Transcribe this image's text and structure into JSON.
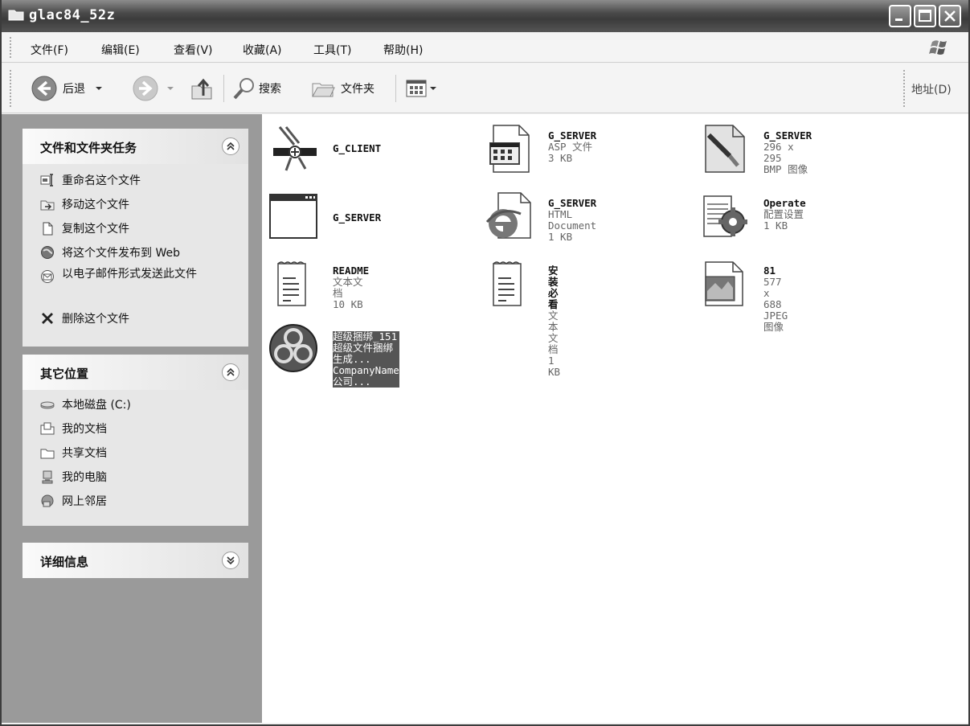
{
  "window": {
    "title": "glac84_52z"
  },
  "menubar": {
    "items": [
      "文件(F)",
      "编辑(E)",
      "查看(V)",
      "收藏(A)",
      "工具(T)",
      "帮助(H)"
    ]
  },
  "toolbar": {
    "back_label": "后退",
    "search_label": "搜索",
    "folders_label": "文件夹",
    "address_label": "地址(D)"
  },
  "left": {
    "tasks_panel": {
      "title": "文件和文件夹任务",
      "items": [
        {
          "label": "重命名这个文件",
          "icon": "rename-icon"
        },
        {
          "label": "移动这个文件",
          "icon": "move-icon"
        },
        {
          "label": "复制这个文件",
          "icon": "copy-icon"
        },
        {
          "label": "将这个文件发布到 Web",
          "icon": "web-publish-icon"
        },
        {
          "label": "以电子邮件形式发送此文件",
          "icon": "email-icon"
        },
        {
          "label": "删除这个文件",
          "icon": "delete-icon"
        }
      ]
    },
    "places_panel": {
      "title": "其它位置",
      "items": [
        {
          "label": "本地磁盘 (C:)",
          "icon": "drive-icon"
        },
        {
          "label": "我的文档",
          "icon": "my-documents-icon"
        },
        {
          "label": "共享文档",
          "icon": "shared-documents-icon"
        },
        {
          "label": "我的电脑",
          "icon": "my-computer-icon"
        },
        {
          "label": "网上邻居",
          "icon": "network-icon"
        }
      ]
    },
    "details_panel": {
      "title": "详细信息"
    }
  },
  "files": [
    {
      "name": "G_CLIENT",
      "line2": "",
      "line3": "",
      "icon": "exe-client-icon"
    },
    {
      "name": "G_SERVER",
      "line2": "ASP 文件",
      "line3": "3 KB",
      "icon": "asp-file-icon"
    },
    {
      "name": "G_SERVER",
      "line2": "296 x 295",
      "line3": "BMP 图像",
      "icon": "bmp-image-icon"
    },
    {
      "name": "G_SERVER",
      "line2": "",
      "line3": "",
      "icon": "exe-window-icon"
    },
    {
      "name": "G_SERVER",
      "line2": "HTML Document",
      "line3": "1 KB",
      "icon": "ie-html-icon"
    },
    {
      "name": "Operate",
      "line2": "配置设置",
      "line3": "1 KB",
      "icon": "config-settings-icon"
    },
    {
      "name": "README",
      "line2": "文本文档",
      "line3": "10 KB",
      "icon": "text-document-icon"
    },
    {
      "name": "安装必看",
      "line2": "文本文档",
      "line3": "1 KB",
      "icon": "text-document-icon"
    },
    {
      "name": "81",
      "line2": "577 x 688",
      "line3": "JPEG 图像",
      "icon": "jpeg-image-icon"
    },
    {
      "name": "超级捆绑_151",
      "line2": "超级文件捆绑生成...",
      "line3": "CompanyName 公司...",
      "icon": "knot-app-icon",
      "selected": true
    }
  ]
}
